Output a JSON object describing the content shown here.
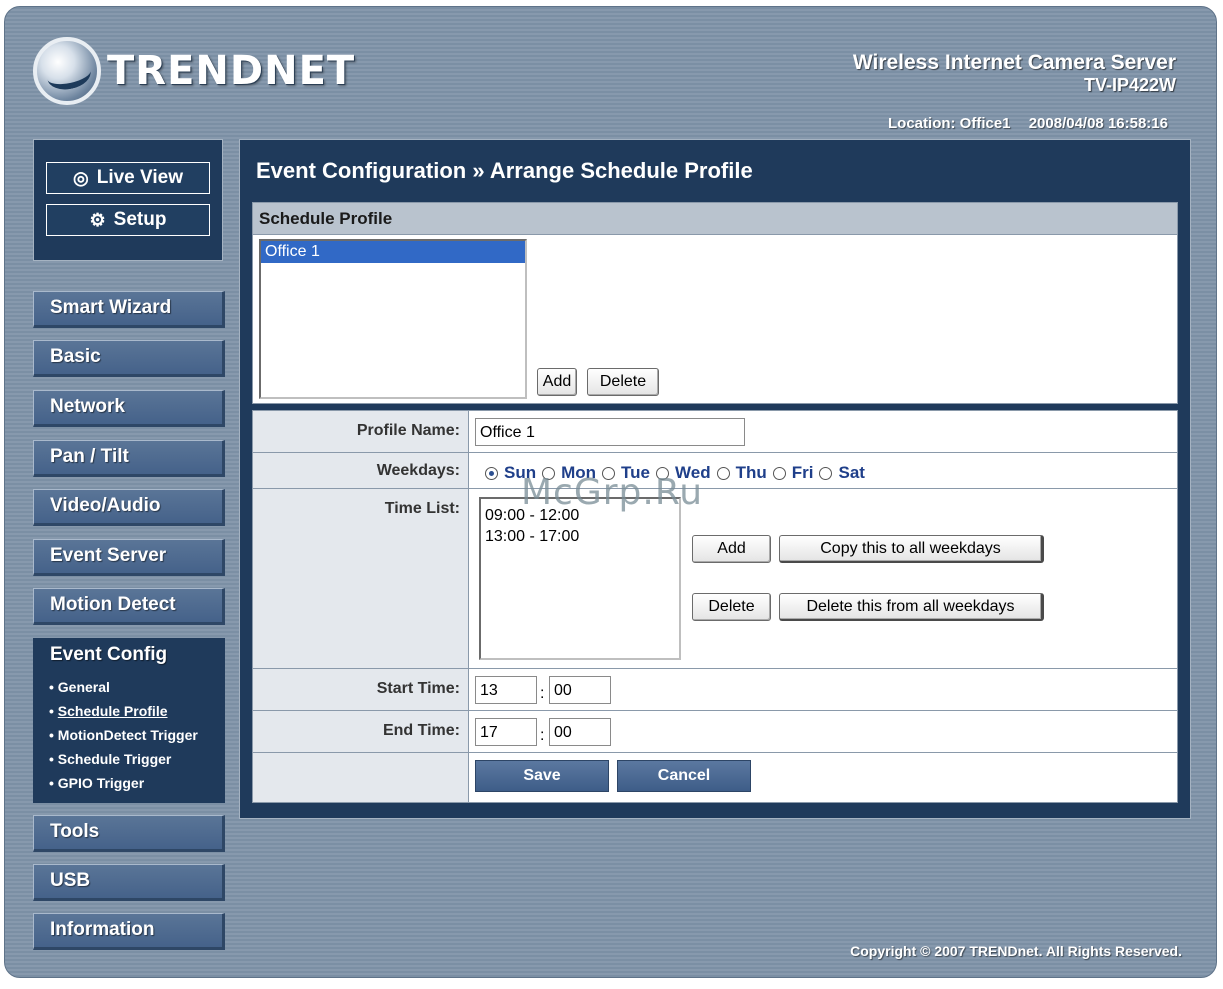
{
  "header": {
    "brand": "TRENDNET",
    "product_line1": "Wireless Internet Camera Server",
    "product_line2": "TV-IP422W",
    "location": "Location: Office1",
    "datetime": "2008/04/08 16:58:16"
  },
  "top_buttons": {
    "live_view": "Live View",
    "setup": "Setup"
  },
  "nav": {
    "smart_wizard": "Smart Wizard",
    "basic": "Basic",
    "network": "Network",
    "pan_tilt": "Pan / Tilt",
    "video_audio": "Video/Audio",
    "event_server": "Event Server",
    "motion_detect": "Motion Detect",
    "event_config": "Event Config",
    "tools": "Tools",
    "usb": "USB",
    "information": "Information"
  },
  "subnav": {
    "general": "• General",
    "schedule_profile": "Schedule Profile",
    "motiondetect_trigger": "• MotionDetect Trigger",
    "schedule_trigger": "• Schedule Trigger",
    "gpio_trigger": "• GPIO Trigger"
  },
  "main": {
    "title": "Event Configuration » Arrange Schedule Profile",
    "schedule_profile_header": "Schedule Profile",
    "profiles": [
      "Office 1"
    ],
    "add_label": "Add",
    "delete_label": "Delete",
    "profile_name_label": "Profile Name:",
    "profile_name_value": "Office 1",
    "weekdays_label": "Weekdays:",
    "weekdays": [
      "Sun",
      "Mon",
      "Tue",
      "Wed",
      "Thu",
      "Fri",
      "Sat"
    ],
    "selected_weekday": "Sun",
    "time_list_label": "Time List:",
    "time_list": [
      "09:00 - 12:00",
      "13:00 - 17:00"
    ],
    "copy_all_label": "Copy this to all weekdays",
    "delete_all_label": "Delete this from all weekdays",
    "start_time_label": "Start Time:",
    "start_hour": "13",
    "start_min": "00",
    "end_time_label": "End Time:",
    "end_hour": "17",
    "end_min": "00",
    "time_sep": ":",
    "save_label": "Save",
    "cancel_label": "Cancel"
  },
  "watermark": "McGrp.Ru",
  "footer": {
    "copyright": "Copyright © 2007 TRENDnet. All Rights Reserved."
  }
}
